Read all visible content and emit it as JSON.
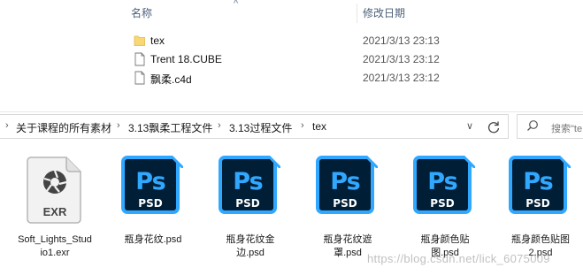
{
  "details": {
    "col_name": "名称",
    "col_date": "修改日期",
    "rows": [
      {
        "name": "tex",
        "date": "2021/3/13 23:13",
        "icon": "folder-icon"
      },
      {
        "name": "Trent 18.CUBE",
        "date": "2021/3/13 23:12",
        "icon": "file-icon"
      },
      {
        "name": "飘柔.c4d",
        "date": "2021/3/13 23:12",
        "icon": "file-icon"
      }
    ]
  },
  "address": {
    "crumbs": [
      "关于课程的所有素材",
      "3.13飘柔工程文件",
      "3.13过程文件",
      "tex"
    ],
    "search_placeholder": "搜索\"te"
  },
  "files": [
    {
      "type": "exr",
      "badge": "EXR",
      "label": "Soft_Lights_Studio1.exr"
    },
    {
      "type": "psd",
      "badge": "Ps",
      "sub": "PSD",
      "label": "瓶身花纹.psd"
    },
    {
      "type": "psd",
      "badge": "Ps",
      "sub": "PSD",
      "label": "瓶身花纹金边.psd"
    },
    {
      "type": "psd",
      "badge": "Ps",
      "sub": "PSD",
      "label": "瓶身花纹遮罩.psd"
    },
    {
      "type": "psd",
      "badge": "Ps",
      "sub": "PSD",
      "label": "瓶身颜色贴图.psd"
    },
    {
      "type": "psd",
      "badge": "Ps",
      "sub": "PSD",
      "label": "瓶身颜色贴图2.psd"
    }
  ],
  "watermark": "https://blog.csdn.net/lick_6075009",
  "colors": {
    "ps_blue": "#31a8ff",
    "ps_dark": "#001e36",
    "folder": "#f8d775"
  }
}
